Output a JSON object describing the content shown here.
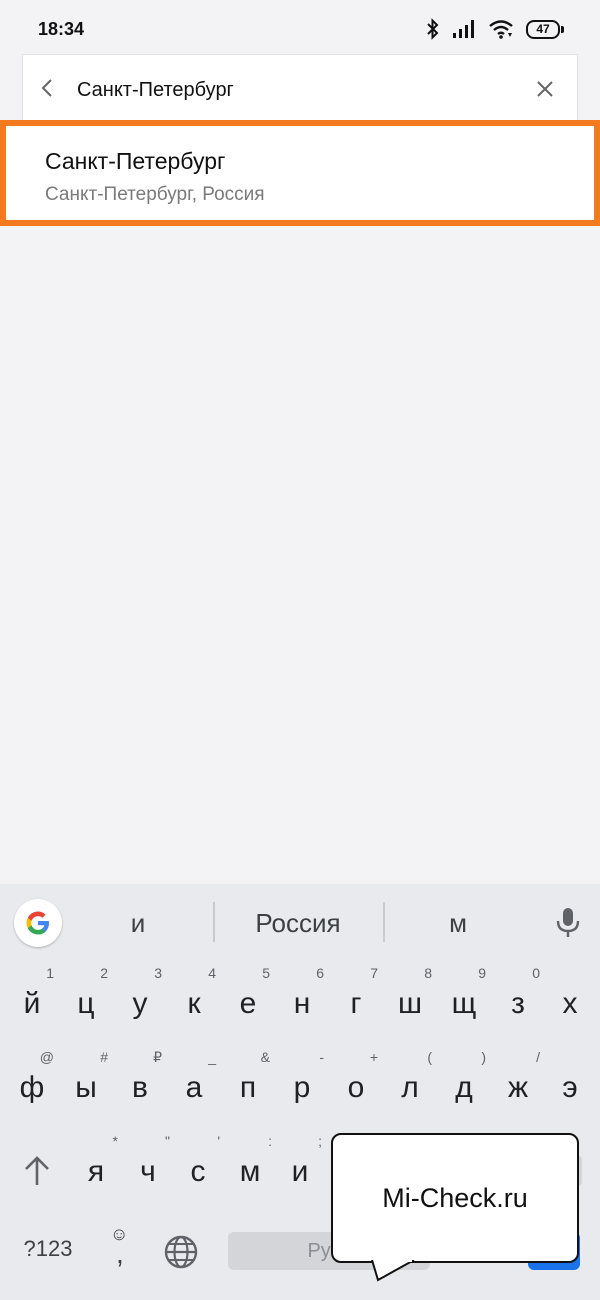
{
  "status_bar": {
    "time": "18:34",
    "battery": "47",
    "icons": [
      "bluetooth-icon",
      "signal-icon",
      "wifi-icon",
      "battery-icon"
    ]
  },
  "search": {
    "query": "Санкт-Петербург"
  },
  "results": [
    {
      "title": "Санкт-Петербург",
      "subtitle": "Санкт-Петербург, Россия"
    }
  ],
  "keyboard": {
    "suggestions": [
      "и",
      "Россия",
      "м"
    ],
    "row1": [
      {
        "k": "й",
        "h": "1"
      },
      {
        "k": "ц",
        "h": "2"
      },
      {
        "k": "у",
        "h": "3"
      },
      {
        "k": "к",
        "h": "4"
      },
      {
        "k": "е",
        "h": "5"
      },
      {
        "k": "н",
        "h": "6"
      },
      {
        "k": "г",
        "h": "7"
      },
      {
        "k": "ш",
        "h": "8"
      },
      {
        "k": "щ",
        "h": "9"
      },
      {
        "k": "з",
        "h": "0"
      },
      {
        "k": "х",
        "h": ""
      }
    ],
    "row2": [
      {
        "k": "ф",
        "h": "@"
      },
      {
        "k": "ы",
        "h": "#"
      },
      {
        "k": "в",
        "h": "₽"
      },
      {
        "k": "а",
        "h": "_"
      },
      {
        "k": "п",
        "h": "&"
      },
      {
        "k": "р",
        "h": "-"
      },
      {
        "k": "о",
        "h": "+"
      },
      {
        "k": "л",
        "h": "("
      },
      {
        "k": "д",
        "h": ")"
      },
      {
        "k": "ж",
        "h": "/"
      },
      {
        "k": "э",
        "h": ""
      }
    ],
    "row3": [
      {
        "k": "я",
        "h": "*"
      },
      {
        "k": "ч",
        "h": "\""
      },
      {
        "k": "с",
        "h": "'"
      },
      {
        "k": "м",
        "h": ":"
      },
      {
        "k": "и",
        "h": ";"
      }
    ],
    "symbols_label": "?123",
    "comma_label": ",",
    "space_label": "Русс",
    "accent_color": "#1a73e8"
  },
  "watermark": {
    "text": "Mi-Check.ru"
  },
  "highlight_color": "#f47a20"
}
